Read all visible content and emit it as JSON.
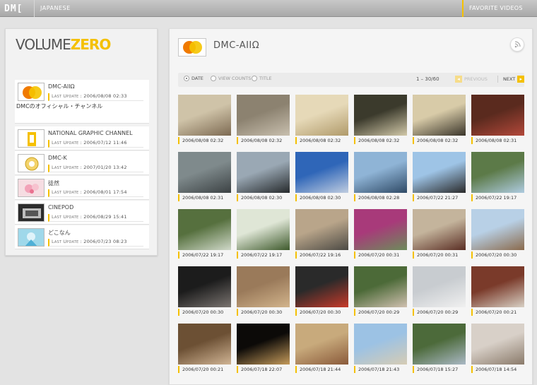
{
  "topbar": {
    "logo": "DM[",
    "language": "JAPANESE",
    "favorites": "FAVORITE VIDEOS"
  },
  "sidebar": {
    "brand_volume": "VOLUME",
    "brand_zero": "ZERO",
    "update_label": "Last Update",
    "channels": [
      {
        "name": "DMC-AIIΩ",
        "updated": "2006/08/08 02:33",
        "description": "DMCのオフィシャル・チャンネル",
        "icon": "two-circles-icon"
      },
      {
        "name": "NATIONAL GRAPHIC CHANNEL",
        "updated": "2006/07/12 11:46",
        "icon": "yellow-frame-icon"
      },
      {
        "name": "DMC-K",
        "updated": "2007/01/20 13:42",
        "icon": "gear-star-icon"
      },
      {
        "name": "徒然",
        "updated": "2006/08/01 17:54",
        "icon": "pink-flower-icon"
      },
      {
        "name": "CINEPOD",
        "updated": "2006/08/29 15:41",
        "icon": "film-strip-icon"
      },
      {
        "name": "どこなん",
        "updated": "2006/07/23 08:23",
        "icon": "anime-character-icon"
      }
    ]
  },
  "main": {
    "title": "DMC-AIIΩ",
    "sort": {
      "date": "DATE",
      "views": "VIEW COUNTS",
      "title": "TITLE",
      "selected": "date"
    },
    "range": "1 – 30/60",
    "prev": "PREVIOUS",
    "next": "NEXT",
    "videos": [
      {
        "date": "2006/08/08 02:32",
        "colors": [
          "#cfc3a8",
          "#7d6a52"
        ]
      },
      {
        "date": "2006/08/08 02:32",
        "colors": [
          "#8c8270",
          "#c8bfae"
        ]
      },
      {
        "date": "2006/08/08 02:32",
        "colors": [
          "#e6d9b8",
          "#b09a6a"
        ]
      },
      {
        "date": "2006/08/08 02:32",
        "colors": [
          "#3b3a2c",
          "#d2c9a9"
        ]
      },
      {
        "date": "2006/08/08 02:32",
        "colors": [
          "#d8cba8",
          "#3a352a"
        ]
      },
      {
        "date": "2006/08/08 02:31",
        "colors": [
          "#5a2a1e",
          "#b3483a"
        ]
      },
      {
        "date": "2006/08/08 02:31",
        "colors": [
          "#7f8a8c",
          "#3c4244"
        ]
      },
      {
        "date": "2006/08/08 02:30",
        "colors": [
          "#9aa8b4",
          "#262a2c"
        ]
      },
      {
        "date": "2006/08/08 02:30",
        "colors": [
          "#2f66b8",
          "#c0cde0"
        ]
      },
      {
        "date": "2006/08/08 02:28",
        "colors": [
          "#8fb4d6",
          "#2f4a66"
        ]
      },
      {
        "date": "2006/07/22 21:27",
        "colors": [
          "#9ec4e6",
          "#2a2a2a"
        ]
      },
      {
        "date": "2006/07/22 19:17",
        "colors": [
          "#5c7a48",
          "#aecbe0"
        ]
      },
      {
        "date": "2006/07/22 19:17",
        "colors": [
          "#56703e",
          "#cfd8c8"
        ]
      },
      {
        "date": "2006/07/22 19:17",
        "colors": [
          "#dfe6d6",
          "#3e5a2c"
        ]
      },
      {
        "date": "2006/07/22 19:16",
        "colors": [
          "#b9a58a",
          "#4c4a44"
        ]
      },
      {
        "date": "2006/07/20 00:31",
        "colors": [
          "#a83a7a",
          "#6c8c5a"
        ]
      },
      {
        "date": "2006/07/20 00:31",
        "colors": [
          "#c4b49c",
          "#5a2e24"
        ]
      },
      {
        "date": "2006/07/20 00:30",
        "colors": [
          "#b8d0e6",
          "#8a6a4c"
        ]
      },
      {
        "date": "2006/07/20 00:30",
        "colors": [
          "#1c1c1c",
          "#7a7470"
        ]
      },
      {
        "date": "2006/07/20 00:30",
        "colors": [
          "#9a7a5a",
          "#d2b48c"
        ]
      },
      {
        "date": "2006/07/20 00:30",
        "colors": [
          "#2a2a2a",
          "#c83a2a"
        ]
      },
      {
        "date": "2006/07/20 00:29",
        "colors": [
          "#4c6a38",
          "#d0c0b0"
        ]
      },
      {
        "date": "2006/07/20 00:29",
        "colors": [
          "#c8ccd0",
          "#f0f0f0"
        ]
      },
      {
        "date": "2006/07/20 00:21",
        "colors": [
          "#7a3a2a",
          "#d8d0c4"
        ]
      },
      {
        "date": "2006/07/20 00:21",
        "colors": [
          "#6c5034",
          "#d0b494"
        ]
      },
      {
        "date": "2006/07/18 22:07",
        "colors": [
          "#0c0a08",
          "#c49a5a"
        ]
      },
      {
        "date": "2006/07/18 21:44",
        "colors": [
          "#c8aa7c",
          "#8a5a3a"
        ]
      },
      {
        "date": "2006/07/18 21:43",
        "colors": [
          "#9cc2e4",
          "#d6ccb4"
        ]
      },
      {
        "date": "2006/07/18 15:27",
        "colors": [
          "#4c6a3a",
          "#aab8c4"
        ]
      },
      {
        "date": "2006/07/18 14:54",
        "colors": [
          "#d8d0c8",
          "#8a7a6a"
        ]
      }
    ]
  }
}
